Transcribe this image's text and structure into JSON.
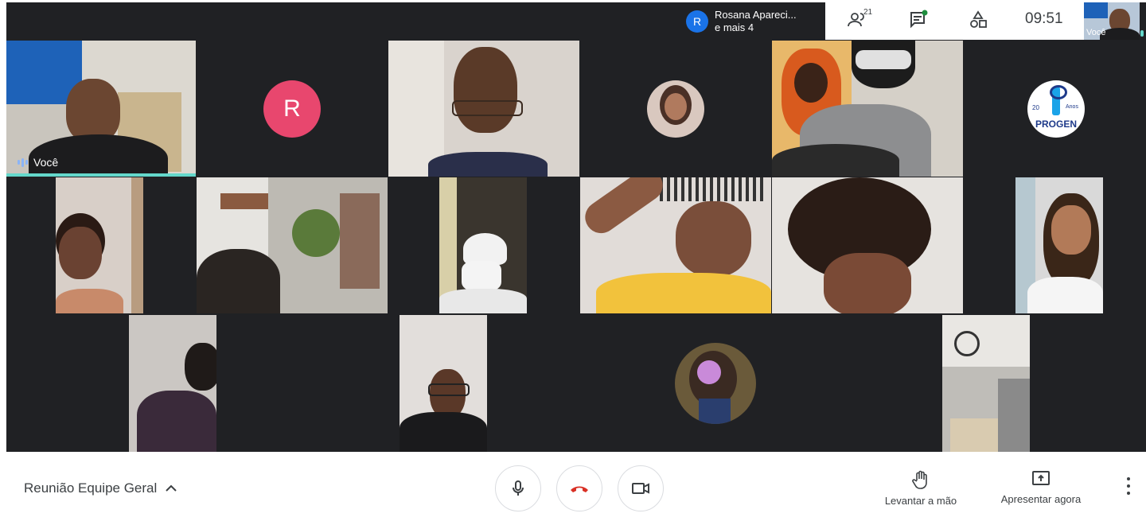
{
  "topbar": {
    "presenter_initial": "R",
    "presenter_line1": "Rosana Apareci...",
    "presenter_line2": "e mais 4",
    "participant_count": "21",
    "time": "09:51",
    "self_label": "Você"
  },
  "tiles": {
    "self_label": "Você",
    "r_initial": "R",
    "logo_text": "PROGEN",
    "logo_small_left": "20",
    "logo_small_right": "Anos"
  },
  "bottom": {
    "meeting_title": "Reunião Equipe Geral",
    "raise_hand_label": "Levantar a mão",
    "present_label": "Apresentar agora"
  },
  "icons": {
    "chevron": "chevron-up-icon",
    "mic": "mic-icon",
    "hangup": "hangup-icon",
    "camera": "camera-icon",
    "people": "people-icon",
    "chat": "chat-icon",
    "activities": "activities-icon",
    "hand": "hand-icon",
    "present": "present-icon",
    "more": "more-vert-icon"
  },
  "colors": {
    "stage": "#202124",
    "avatar_r_tile": "#e8476e",
    "presenter_avatar": "#1a73e8",
    "speaking_indicator": "#64d8cb",
    "hangup_red": "#d93025",
    "text_dark": "#3c4043"
  }
}
